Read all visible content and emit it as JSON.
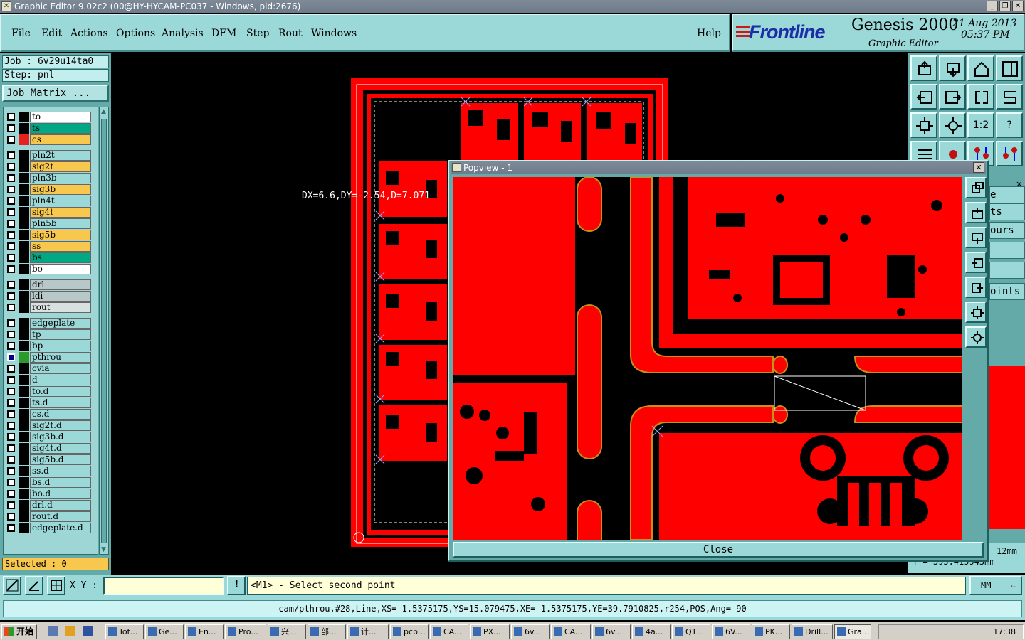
{
  "window": {
    "title": "Graphic Editor 9.02c2 (00@HY-HYCAM-PC037 - Windows, pid:2676)"
  },
  "menu": [
    "File",
    "Edit",
    "Actions",
    "Options",
    "Analysis",
    "DFM",
    "Step",
    "Rout",
    "Windows"
  ],
  "help": "Help",
  "brand": {
    "logo": "Frontline",
    "product": "Genesis 2000",
    "subtitle": "Graphic Editor",
    "date": "21 Aug 2013",
    "time": "05:37 PM"
  },
  "job": {
    "job": "Job : 6v29u14ta0",
    "step": "Step: pnl",
    "matrix_button": "Job Matrix ..."
  },
  "layers": [
    {
      "name": "to",
      "color": "#ffffff",
      "dot": "#000000"
    },
    {
      "name": "ts",
      "color": "#00a884",
      "dot": "#000000"
    },
    {
      "name": "cs",
      "color": "#f8c84e",
      "dot": "#e82020"
    },
    {
      "name": "pln2t",
      "color": "#9bd8d8",
      "dot": "#000000"
    },
    {
      "name": "sig2t",
      "color": "#f8c84e",
      "dot": "#000000"
    },
    {
      "name": "pln3b",
      "color": "#9bd8d8",
      "dot": "#000000"
    },
    {
      "name": "sig3b",
      "color": "#f8c84e",
      "dot": "#000000"
    },
    {
      "name": "pln4t",
      "color": "#9bd8d8",
      "dot": "#000000"
    },
    {
      "name": "sig4t",
      "color": "#f8c84e",
      "dot": "#000000"
    },
    {
      "name": "pln5b",
      "color": "#9bd8d8",
      "dot": "#000000"
    },
    {
      "name": "sig5b",
      "color": "#f8c84e",
      "dot": "#000000"
    },
    {
      "name": "ss",
      "color": "#f8c84e",
      "dot": "#000000"
    },
    {
      "name": "bs",
      "color": "#00a884",
      "dot": "#000000"
    },
    {
      "name": "bo",
      "color": "#ffffff",
      "dot": "#000000"
    },
    {
      "name": "drl",
      "color": "#b8c8c8",
      "dot": "#000000"
    },
    {
      "name": "ldi",
      "color": "#b8c8c8",
      "dot": "#000000"
    },
    {
      "name": "rout",
      "color": "#d8e0e0",
      "dot": "#000000"
    },
    {
      "name": "edgeplate",
      "color": "#9bd8d8",
      "dot": "#000000"
    },
    {
      "name": "tp",
      "color": "#9bd8d8",
      "dot": "#000000"
    },
    {
      "name": "bp",
      "color": "#9bd8d8",
      "dot": "#000000"
    },
    {
      "name": "pthrou",
      "color": "#9bd8d8",
      "dot": "#2a9a2a",
      "on": true
    },
    {
      "name": "cvia",
      "color": "#9bd8d8",
      "dot": "#000000"
    },
    {
      "name": "d",
      "color": "#9bd8d8",
      "dot": "#000000"
    },
    {
      "name": "to.d",
      "color": "#9bd8d8",
      "dot": "#000000"
    },
    {
      "name": "ts.d",
      "color": "#9bd8d8",
      "dot": "#000000"
    },
    {
      "name": "cs.d",
      "color": "#9bd8d8",
      "dot": "#000000"
    },
    {
      "name": "sig2t.d",
      "color": "#9bd8d8",
      "dot": "#000000"
    },
    {
      "name": "sig3b.d",
      "color": "#9bd8d8",
      "dot": "#000000"
    },
    {
      "name": "sig4t.d",
      "color": "#9bd8d8",
      "dot": "#000000"
    },
    {
      "name": "sig5b.d",
      "color": "#9bd8d8",
      "dot": "#000000"
    },
    {
      "name": "ss.d",
      "color": "#9bd8d8",
      "dot": "#000000"
    },
    {
      "name": "bs.d",
      "color": "#9bd8d8",
      "dot": "#000000"
    },
    {
      "name": "bo.d",
      "color": "#9bd8d8",
      "dot": "#000000"
    },
    {
      "name": "drl.d",
      "color": "#9bd8d8",
      "dot": "#000000"
    },
    {
      "name": "rout.d",
      "color": "#9bd8d8",
      "dot": "#000000"
    },
    {
      "name": "edgeplate.d",
      "color": "#9bd8d8",
      "dot": "#000000"
    }
  ],
  "selected": "Selected : 0",
  "measure": "DX=6.6,DY=-2.54,D=7.071",
  "popview": {
    "title": "Popview - 1",
    "close_label": "Close"
  },
  "toolbar_buttons": [
    "zoom-home-icon",
    "zoom-down-icon",
    "home-icon",
    "split-icon",
    "pan-left-icon",
    "pan-right-icon",
    "flip-icon",
    "snake-icon",
    "fit-icon",
    "center-icon",
    "1:2",
    "help-icon",
    "settings-icon",
    "display-icon",
    "layers-red-icon",
    "layers-red2-icon"
  ],
  "right_labels": [
    "e",
    "ts",
    "ours",
    "",
    "",
    "oints"
  ],
  "coords": {
    "x": "12mm",
    "y": "Y = 395.419945mm"
  },
  "command": {
    "xy_label": "X Y :",
    "xy_value": "",
    "prompt": "<M1> - Select second point",
    "units": "MM"
  },
  "status": "cam/pthrou,#28,Line,XS=-1.5375175,YS=15.079475,XE=-1.5375175,YE=39.7910825,r254,POS,Ang=-90",
  "taskbar": {
    "start": "开始",
    "tasks": [
      "Tot...",
      "Ge...",
      "En...",
      "Pro...",
      "兴...",
      "部...",
      "计...",
      "pcb...",
      "CA...",
      "PX...",
      "6v...",
      "CA...",
      "6v...",
      "4a...",
      "Q1...",
      "6V...",
      "PK...",
      "Drill...",
      "Gra..."
    ],
    "clock": "17:38"
  },
  "colors": {
    "copper": "#ff0000",
    "plating": "#c89018",
    "panel": "#9bd8d8"
  }
}
